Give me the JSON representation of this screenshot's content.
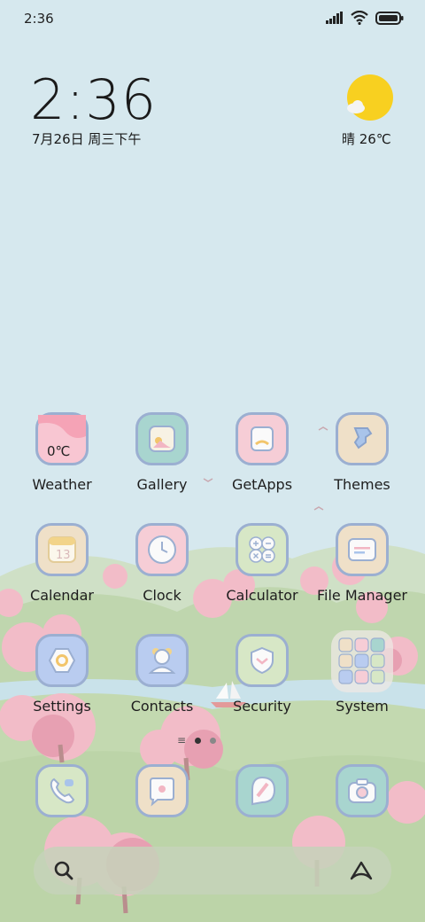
{
  "status_bar": {
    "time": "2:36",
    "icons": [
      "signal-icon",
      "wifi-icon",
      "battery-icon"
    ]
  },
  "clock_widget": {
    "time": "2:36",
    "date": "7月26日 周三下午"
  },
  "weather_widget": {
    "condition_temp": "晴 26℃",
    "icon": "sun-with-cloud-icon"
  },
  "apps": [
    {
      "label": "Weather",
      "icon": "weather-icon",
      "badge": "0℃"
    },
    {
      "label": "Gallery",
      "icon": "gallery-icon"
    },
    {
      "label": "GetApps",
      "icon": "getapps-icon"
    },
    {
      "label": "Themes",
      "icon": "themes-icon"
    },
    {
      "label": "Calendar",
      "icon": "calendar-icon",
      "badge": "13"
    },
    {
      "label": "Clock",
      "icon": "clock-icon"
    },
    {
      "label": "Calculator",
      "icon": "calculator-icon"
    },
    {
      "label": "File Manager",
      "icon": "file-manager-icon"
    },
    {
      "label": "Settings",
      "icon": "settings-icon"
    },
    {
      "label": "Contacts",
      "icon": "contacts-icon"
    },
    {
      "label": "Security",
      "icon": "security-icon"
    },
    {
      "label": "System",
      "icon": "folder-icon"
    }
  ],
  "dock": [
    {
      "icon": "phone-icon"
    },
    {
      "icon": "messages-icon"
    },
    {
      "icon": "browser-icon"
    },
    {
      "icon": "camera-icon"
    }
  ],
  "search_bar": {
    "left_icon": "search-icon",
    "right_icon": "assistant-icon"
  },
  "colors": {
    "sky": "#d6e8ee",
    "hill_green": "#b9d1a6",
    "blossom_pink": "#f2b6c3",
    "icon_border": "#9bafd1",
    "sun": "#f8d020"
  }
}
